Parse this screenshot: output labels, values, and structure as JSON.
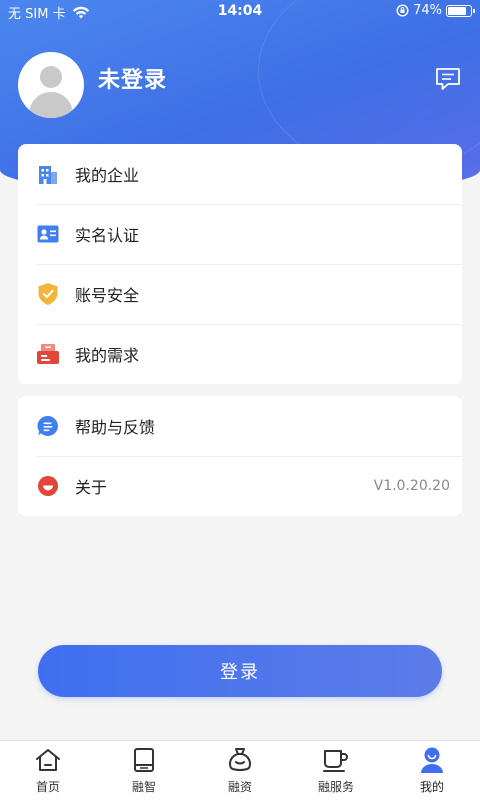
{
  "status_bar": {
    "carrier": "无 SIM 卡",
    "time": "14:04",
    "battery": "74%",
    "battery_level": 0.74
  },
  "profile": {
    "username": "未登录"
  },
  "menu_group_1": [
    {
      "label": "我的企业",
      "icon": "building-icon"
    },
    {
      "label": "实名认证",
      "icon": "id-card-icon"
    },
    {
      "label": "账号安全",
      "icon": "shield-icon"
    },
    {
      "label": "我的需求",
      "icon": "demand-icon"
    }
  ],
  "menu_group_2": [
    {
      "label": "帮助与反馈",
      "icon": "help-chat-icon"
    },
    {
      "label": "关于",
      "icon": "about-icon",
      "value": "V1.0.20.20"
    }
  ],
  "login_button": "登录",
  "tabbar": [
    {
      "label": "首页",
      "icon": "home-icon"
    },
    {
      "label": "融智",
      "icon": "book-icon"
    },
    {
      "label": "融资",
      "icon": "money-bag-icon"
    },
    {
      "label": "融服务",
      "icon": "cup-icon"
    },
    {
      "label": "我的",
      "icon": "user-icon",
      "active": true
    }
  ],
  "colors": {
    "primary": "#3f6ff0",
    "background": "#f4f4f4"
  }
}
